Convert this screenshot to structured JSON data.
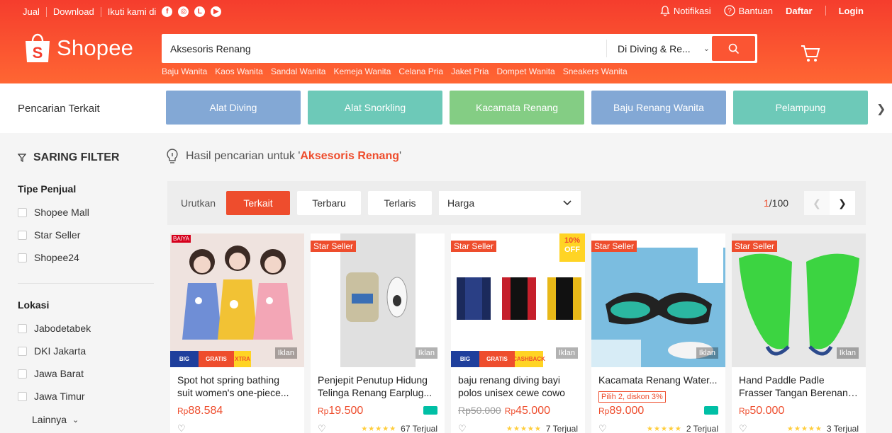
{
  "topbar": {
    "left_links": [
      "Jual",
      "Download"
    ],
    "follow_label": "Ikuti kami di",
    "notif_label": "Notifikasi",
    "help_label": "Bantuan",
    "signup_label": "Daftar",
    "login_label": "Login"
  },
  "brand": {
    "name": "Shopee",
    "color": "#ee4d2d"
  },
  "search": {
    "value": "Aksesoris Renang",
    "scope": "Di Diving & Re...",
    "suggestions": [
      "Baju Wanita",
      "Kaos Wanita",
      "Sandal Wanita",
      "Kemeja Wanita",
      "Celana Pria",
      "Jaket Pria",
      "Dompet Wanita",
      "Sneakers Wanita"
    ]
  },
  "related": {
    "label": "Pencarian Terkait",
    "chips": [
      {
        "label": "Alat Diving",
        "color": "#83a8d5"
      },
      {
        "label": "Alat Snorkling",
        "color": "#6dc9b8"
      },
      {
        "label": "Kacamata Renang",
        "color": "#84cd84"
      },
      {
        "label": "Baju Renang Wanita",
        "color": "#83a8d5"
      },
      {
        "label": "Pelampung",
        "color": "#6dc9b8"
      }
    ]
  },
  "sidebar": {
    "filter_title": "SARING FILTER",
    "seller_type": {
      "title": "Tipe Penjual",
      "options": [
        "Shopee Mall",
        "Star Seller",
        "Shopee24"
      ]
    },
    "location": {
      "title": "Lokasi",
      "options": [
        "Jabodetabek",
        "DKI Jakarta",
        "Jawa Barat",
        "Jawa Timur"
      ],
      "more_label": "Lainnya"
    }
  },
  "results": {
    "prefix": "Hasil pencarian untuk '",
    "keyword": "Aksesoris Renang",
    "suffix": "'"
  },
  "sort": {
    "label": "Urutkan",
    "options": [
      "Terkait",
      "Terbaru",
      "Terlaris"
    ],
    "active": "Terkait",
    "price_label": "Harga",
    "page_current": "1",
    "page_total": "/100"
  },
  "products": [
    {
      "name": "Spot hot spring bathing suit women's one-piece...",
      "price": "88.584",
      "old_price": "",
      "sold": "",
      "badge": "",
      "currency": "Rp",
      "ad": "Iklan",
      "store_badge": "BAIYA"
    },
    {
      "name": "Penjepit Penutup Hidung Telinga Renang Earplug...",
      "price": "19.500",
      "old_price": "",
      "sold": "67 Terjual",
      "badge": "Star Seller",
      "currency": "Rp",
      "ad": "Iklan"
    },
    {
      "name": "baju renang diving bayi polos unisex cewe cowo",
      "price": "45.000",
      "old_price": "Rp50.000",
      "sold": "7 Terjual",
      "badge": "Star Seller",
      "currency": "Rp",
      "ad": "Iklan",
      "discount": "10%",
      "discount_off": "OFF"
    },
    {
      "name": "Kacamata Renang Water...",
      "price": "89.000",
      "old_price": "",
      "sold": "2 Terjual",
      "badge": "Star Seller",
      "currency": "Rp",
      "ad": "Iklan",
      "voucher": "Pilih 2, diskon 3%"
    },
    {
      "name": "Hand Paddle Padle Frasser Tangan Berenang Renan...",
      "price": "50.000",
      "old_price": "",
      "sold": "3 Terjual",
      "badge": "Star Seller",
      "currency": "Rp",
      "ad": "Iklan"
    }
  ]
}
